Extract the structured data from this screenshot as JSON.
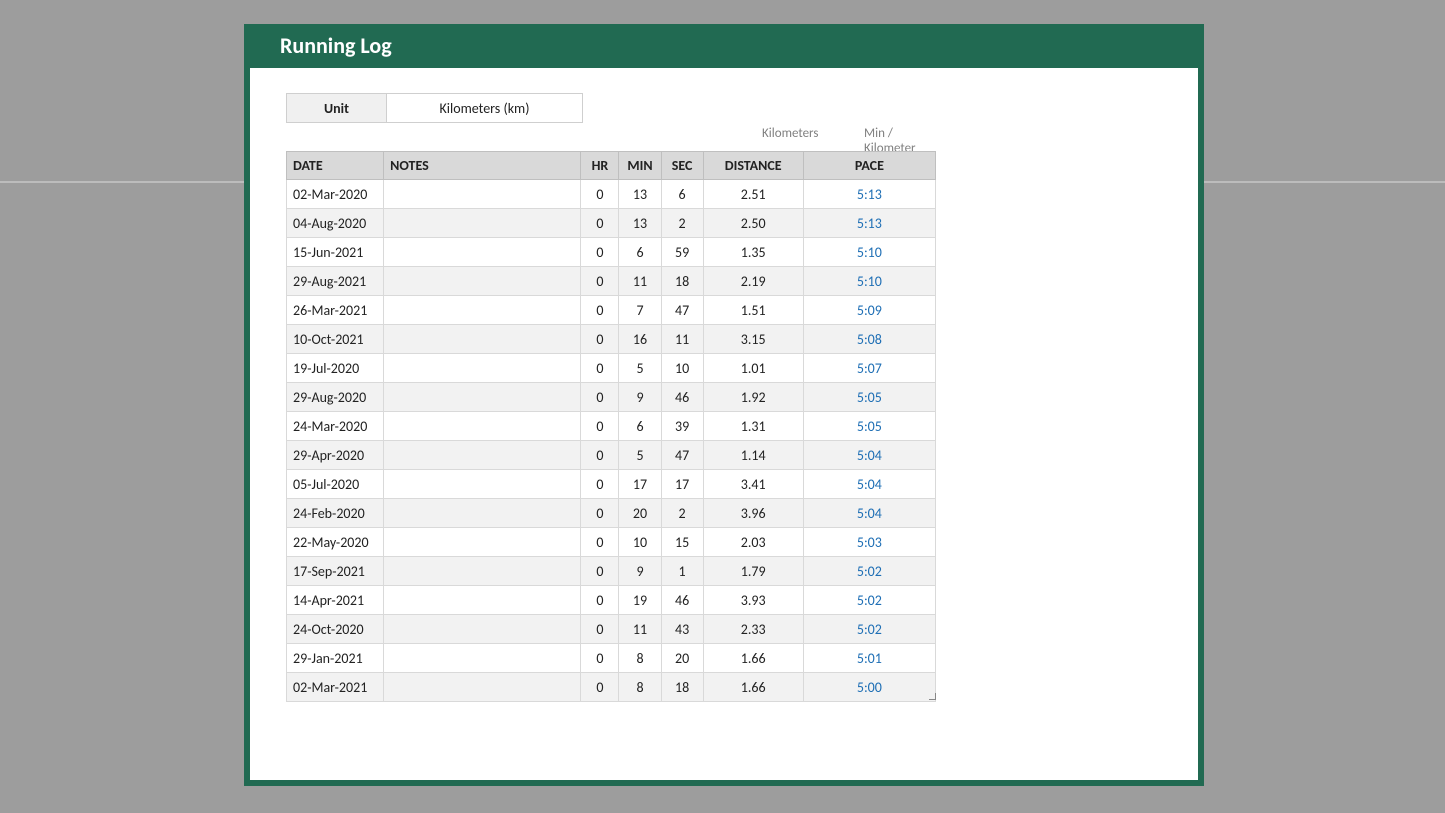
{
  "title": "Running Log",
  "unit": {
    "label": "Unit",
    "value": "Kilometers (km)"
  },
  "sub_labels": {
    "distance": "Kilometers",
    "pace": "Min / Kilometer"
  },
  "headers": {
    "date": "DATE",
    "notes": "NOTES",
    "hr": "HR",
    "min": "MIN",
    "sec": "SEC",
    "distance": "DISTANCE",
    "pace": "PACE"
  },
  "rows": [
    {
      "date": "02-Mar-2020",
      "notes": "",
      "hr": "0",
      "min": "13",
      "sec": "6",
      "distance": "2.51",
      "pace": "5:13"
    },
    {
      "date": "04-Aug-2020",
      "notes": "",
      "hr": "0",
      "min": "13",
      "sec": "2",
      "distance": "2.50",
      "pace": "5:13"
    },
    {
      "date": "15-Jun-2021",
      "notes": "",
      "hr": "0",
      "min": "6",
      "sec": "59",
      "distance": "1.35",
      "pace": "5:10"
    },
    {
      "date": "29-Aug-2021",
      "notes": "",
      "hr": "0",
      "min": "11",
      "sec": "18",
      "distance": "2.19",
      "pace": "5:10"
    },
    {
      "date": "26-Mar-2021",
      "notes": "",
      "hr": "0",
      "min": "7",
      "sec": "47",
      "distance": "1.51",
      "pace": "5:09"
    },
    {
      "date": "10-Oct-2021",
      "notes": "",
      "hr": "0",
      "min": "16",
      "sec": "11",
      "distance": "3.15",
      "pace": "5:08"
    },
    {
      "date": "19-Jul-2020",
      "notes": "",
      "hr": "0",
      "min": "5",
      "sec": "10",
      "distance": "1.01",
      "pace": "5:07"
    },
    {
      "date": "29-Aug-2020",
      "notes": "",
      "hr": "0",
      "min": "9",
      "sec": "46",
      "distance": "1.92",
      "pace": "5:05"
    },
    {
      "date": "24-Mar-2020",
      "notes": "",
      "hr": "0",
      "min": "6",
      "sec": "39",
      "distance": "1.31",
      "pace": "5:05"
    },
    {
      "date": "29-Apr-2020",
      "notes": "",
      "hr": "0",
      "min": "5",
      "sec": "47",
      "distance": "1.14",
      "pace": "5:04"
    },
    {
      "date": "05-Jul-2020",
      "notes": "",
      "hr": "0",
      "min": "17",
      "sec": "17",
      "distance": "3.41",
      "pace": "5:04"
    },
    {
      "date": "24-Feb-2020",
      "notes": "",
      "hr": "0",
      "min": "20",
      "sec": "2",
      "distance": "3.96",
      "pace": "5:04"
    },
    {
      "date": "22-May-2020",
      "notes": "",
      "hr": "0",
      "min": "10",
      "sec": "15",
      "distance": "2.03",
      "pace": "5:03"
    },
    {
      "date": "17-Sep-2021",
      "notes": "",
      "hr": "0",
      "min": "9",
      "sec": "1",
      "distance": "1.79",
      "pace": "5:02"
    },
    {
      "date": "14-Apr-2021",
      "notes": "",
      "hr": "0",
      "min": "19",
      "sec": "46",
      "distance": "3.93",
      "pace": "5:02"
    },
    {
      "date": "24-Oct-2020",
      "notes": "",
      "hr": "0",
      "min": "11",
      "sec": "43",
      "distance": "2.33",
      "pace": "5:02"
    },
    {
      "date": "29-Jan-2021",
      "notes": "",
      "hr": "0",
      "min": "8",
      "sec": "20",
      "distance": "1.66",
      "pace": "5:01"
    },
    {
      "date": "02-Mar-2021",
      "notes": "",
      "hr": "0",
      "min": "8",
      "sec": "18",
      "distance": "1.66",
      "pace": "5:00"
    }
  ]
}
